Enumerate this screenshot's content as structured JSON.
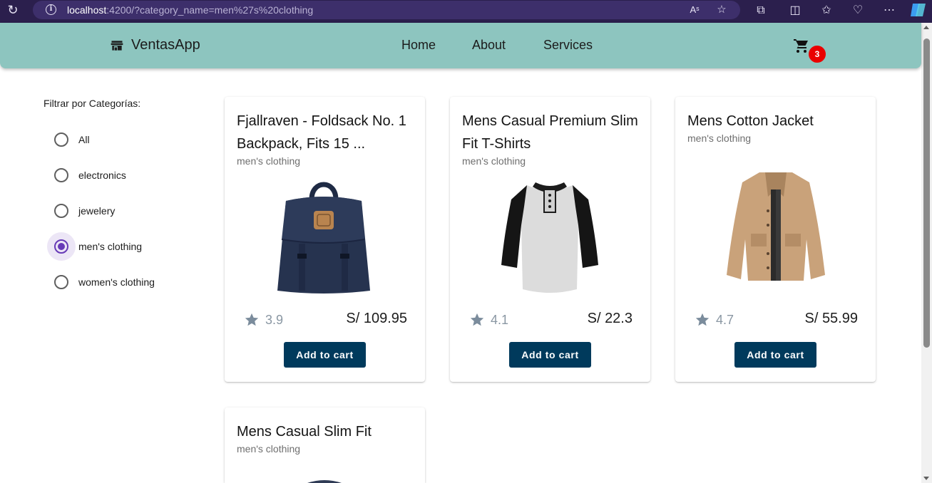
{
  "browser": {
    "url_host": "localhost",
    "url_rest": ":4200/?category_name=men%27s%20clothing"
  },
  "app": {
    "brand": "VentasApp",
    "nav": [
      "Home",
      "About",
      "Services"
    ],
    "cart_count": "3"
  },
  "sidebar": {
    "title": "Filtrar por Categorías:",
    "options": [
      {
        "label": "All",
        "selected": false
      },
      {
        "label": "electronics",
        "selected": false
      },
      {
        "label": "jewelery",
        "selected": false
      },
      {
        "label": "men's clothing",
        "selected": true
      },
      {
        "label": "women's clothing",
        "selected": false
      }
    ]
  },
  "products": [
    {
      "title": "Fjallraven - Foldsack No. 1 Backpack, Fits 15 ...",
      "category": "men's clothing",
      "rating": "3.9",
      "price": "S/ 109.95",
      "button": "Add to cart",
      "image": "backpack"
    },
    {
      "title": "Mens Casual Premium Slim Fit T-Shirts",
      "category": "men's clothing",
      "rating": "4.1",
      "price": "S/ 22.3",
      "button": "Add to cart",
      "image": "raglan-tshirt"
    },
    {
      "title": "Mens Cotton Jacket",
      "category": "men's clothing",
      "rating": "4.7",
      "price": "S/ 55.99",
      "button": "Add to cart",
      "image": "cotton-jacket"
    },
    {
      "title": "Mens Casual Slim Fit",
      "category": "men's clothing",
      "image": "slim-fit-shirt"
    }
  ],
  "icons": {
    "reload": "reload-icon",
    "info": "info-icon",
    "store": "storefront-icon",
    "cart": "shopping-cart-icon",
    "star": "star-icon"
  },
  "colors": {
    "toolbar": "#8dc5bf",
    "button": "#003a5c",
    "badge": "#ea0000",
    "radio_selected": "#673ab7",
    "browser_chrome": "#2b1f4d"
  }
}
